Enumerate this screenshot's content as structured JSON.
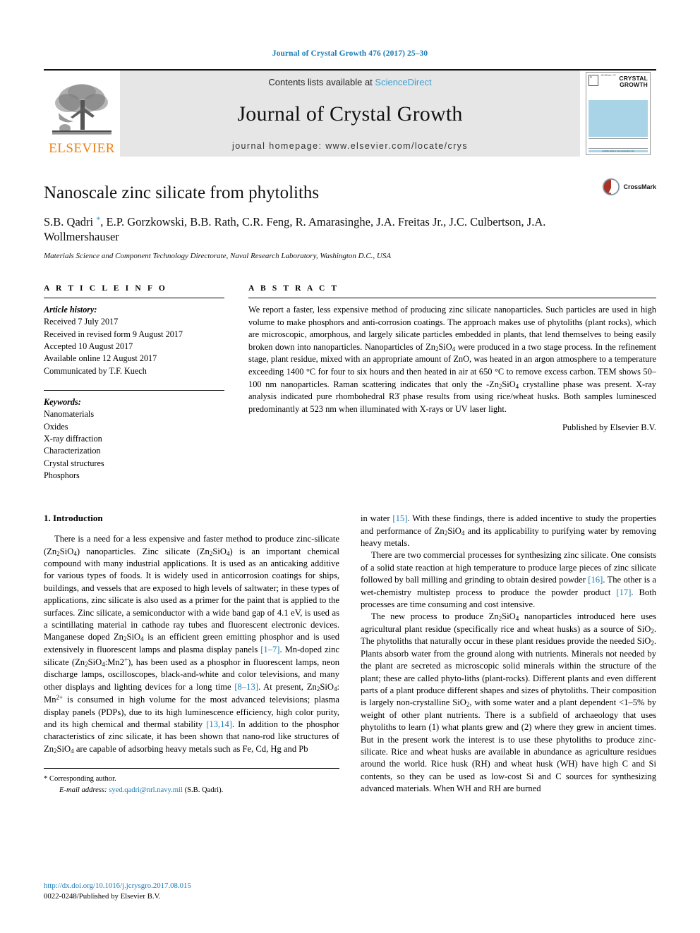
{
  "running_head": "Journal of Crystal Growth 476 (2017) 25–30",
  "masthead": {
    "publisher_name": "ELSEVIER",
    "contents_prefix": "Contents lists available at ",
    "contents_link": "ScienceDirect",
    "journal_title": "Journal of Crystal Growth",
    "homepage": "journal homepage: www.elsevier.com/locate/crys",
    "cover": {
      "line1": "CRYSTAL",
      "line2": "GROWTH",
      "journal_of": "JOURNAL OF",
      "footer_text": "Available online at www.sciencedirect.com"
    }
  },
  "article": {
    "title": "Nanoscale zinc silicate from phytoliths",
    "authors": "S.B. Qadri *, E.P. Gorzkowski, B.B. Rath, C.R. Feng, R. Amarasinghe, J.A. Freitas Jr., J.C. Culbertson, J.A. Wollmershauser",
    "affiliation": "Materials Science and Component Technology Directorate, Naval Research Laboratory, Washington D.C., USA",
    "crossmark_label": "CrossMark"
  },
  "article_info": {
    "heading": "A R T I C L E   I N F O",
    "history_label": "Article history:",
    "history": [
      "Received 7 July 2017",
      "Received in revised form 9 August 2017",
      "Accepted 10 August 2017",
      "Available online 12 August 2017",
      "Communicated by T.F. Kuech"
    ],
    "keywords_label": "Keywords:",
    "keywords": [
      "Nanomaterials",
      "Oxides",
      "X-ray diffraction",
      "Characterization",
      "Crystal structures",
      "Phosphors"
    ]
  },
  "abstract": {
    "heading": "A B S T R A C T",
    "text_part1": "We report a faster, less expensive method of producing zinc silicate nanoparticles. Such particles are used in high volume to make phosphors and anti-corrosion coatings. The approach makes use of phytoliths (plant rocks), which are microscopic, amorphous, and largely silicate particles embedded in plants, that lend themselves to being easily broken down into nanoparticles. Nanoparticles of Zn",
    "text_part2": " were produced in a two stage process. In the refinement stage, plant residue, mixed with an appropriate amount of ZnO, was heated in an argon atmosphere to a temperature exceeding 1400 °C for four to six hours and then heated in air at 650 °C to remove excess carbon. TEM shows 50–100 nm nanoparticles. Raman scattering indicates that only the -Zn",
    "text_part3": " crystalline phase was present. X-ray analysis indicated pure rhombohedral R3̄ phase results from using rice/wheat husks. Both samples luminesced predominantly at 523 nm when illuminated with X-rays or UV laser light.",
    "published_by": "Published by Elsevier B.V."
  },
  "body": {
    "section_title": "1. Introduction",
    "left_paragraphs": [
      "There is a need for a less expensive and faster method to produce zinc-silicate (Zn2SiO4) nanoparticles. Zinc silicate (Zn2SiO4) is an important chemical compound with many industrial applications. It is used as an anticaking additive for various types of foods. It is widely used in anticorrosion coatings for ships, buildings, and vessels that are exposed to high levels of saltwater; in these types of applications, zinc silicate is also used as a primer for the paint that is applied to the surfaces. Zinc silicate, a semiconductor with a wide band gap of 4.1 eV, is used as a scintillating material in cathode ray tubes and fluorescent electronic devices. Manganese doped Zn2SiO4 is an efficient green emitting phosphor and is used extensively in fluorescent lamps and plasma display panels [1–7]. Mn-doped zinc silicate (Zn2SiO4:Mn2+), has been used as a phosphor in fluorescent lamps, neon discharge lamps, oscilloscopes, black-and-white and color televisions, and many other displays and lighting devices for a long time [8–13]. At present, Zn2SiO4:Mn2+ is consumed in high volume for the most advanced televisions; plasma display panels (PDPs), due to its high luminescence efficiency, high color purity, and its high chemical and thermal stability [13,14]. In addition to the phosphor characteristics of zinc silicate, it has been shown that nano-rod like structures of Zn2SiO4 are capable of adsorbing heavy metals such as Fe, Cd, Hg and Pb"
    ],
    "right_paragraphs": [
      "in water [15]. With these findings, there is added incentive to study the properties and performance of Zn2SiO4 and its applicability to purifying water by removing heavy metals.",
      "There are two commercial processes for synthesizing zinc silicate. One consists of a solid state reaction at high temperature to produce large pieces of zinc silicate followed by ball milling and grinding to obtain desired powder [16]. The other is a wet-chemistry multistep process to produce the powder product [17]. Both processes are time consuming and cost intensive.",
      "The new process to produce Zn2SiO4 nanoparticles introduced here uses agricultural plant residue (specifically rice and wheat husks) as a source of SiO2. The phytoliths that naturally occur in these plant residues provide the needed SiO2. Plants absorb water from the ground along with nutrients. Minerals not needed by the plant are secreted as microscopic solid minerals within the structure of the plant; these are called phyto-liths (plant-rocks). Different plants and even different parts of a plant produce different shapes and sizes of phytoliths. Their composition is largely non-crystalline SiO2, with some water and a plant dependent <1–5% by weight of other plant nutrients. There is a subfield of archaeology that uses phytoliths to learn (1) what plants grew and (2) where they grew in ancient times. But in the present work the interest is to use these phytoliths to produce zinc-silicate. Rice and wheat husks are available in abundance as agriculture residues around the world. Rice husk (RH) and wheat husk (WH) have high C and Si contents, so they can be used as low-cost Si and C sources for synthesizing advanced materials. When WH and RH are burned"
    ]
  },
  "footnote": {
    "corresponding_author": "Corresponding author.",
    "email_label": "E-mail address:",
    "email": "syed.qadri@nrl.navy.mil",
    "email_suffix": "(S.B. Qadri)."
  },
  "footer": {
    "doi": "http://dx.doi.org/10.1016/j.jcrysgro.2017.08.015",
    "copyright": "0022-0248/Published by Elsevier B.V."
  },
  "colors": {
    "link_blue": "#1a7cb7",
    "sciencedirect_blue": "#3aa0d1",
    "elsevier_orange": "#ec8013",
    "banner_gray": "#e6e6e6",
    "cover_blue": "#a9d4e8",
    "crossmark_red": "#a93226"
  }
}
